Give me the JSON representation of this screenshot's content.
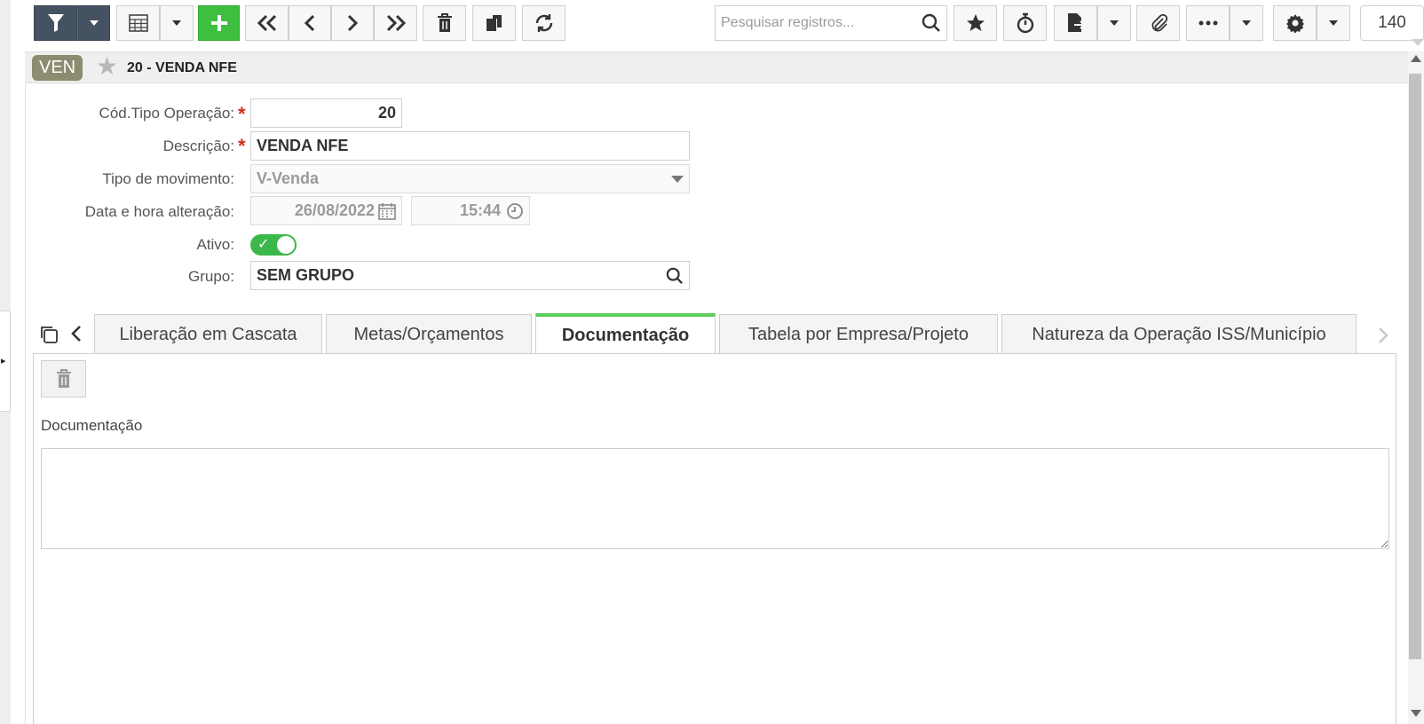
{
  "toolbar": {
    "search_placeholder": "Pesquisar registros...",
    "record_count": "140",
    "icons": [
      "filter-icon",
      "caret-down-icon",
      "grid-icon",
      "plus-icon",
      "first-icon",
      "prev-icon",
      "next-icon",
      "last-icon",
      "trash-icon",
      "copy-icon",
      "refresh-icon",
      "search-icon",
      "star-icon",
      "stopwatch-icon",
      "export-icon",
      "paperclip-icon",
      "more-icon",
      "gear-icon"
    ]
  },
  "header": {
    "module_badge": "VEN",
    "title": "20 - VENDA NFE"
  },
  "form": {
    "cod_tipo_label": "Cód.Tipo Operação:",
    "cod_tipo_value": "20",
    "descricao_label": "Descrição:",
    "descricao_value": "VENDA NFE",
    "tipo_movimento_label": "Tipo de movimento:",
    "tipo_movimento_value": "V-Venda",
    "data_hora_label": "Data e hora alteração:",
    "data_value": "26/08/2022",
    "hora_value": "15:44",
    "ativo_label": "Ativo:",
    "ativo_value": true,
    "grupo_label": "Grupo:",
    "grupo_value": "SEM GRUPO",
    "required_marker": "*"
  },
  "tabs": [
    {
      "label": "Liberação em Cascata",
      "active": false
    },
    {
      "label": "Metas/Orçamentos",
      "active": false
    },
    {
      "label": "Documentação",
      "active": true
    },
    {
      "label": "Tabela por Empresa/Projeto",
      "active": false
    },
    {
      "label": "Natureza da Operação ISS/Município",
      "active": false
    }
  ],
  "panel": {
    "doc_label": "Documentação",
    "doc_value": ""
  },
  "colors": {
    "accent_green": "#3fbf3f",
    "dark_button": "#455261",
    "badge": "#8c8c70",
    "required": "#d0321e",
    "active_tab_border": "#5ccc5c"
  }
}
